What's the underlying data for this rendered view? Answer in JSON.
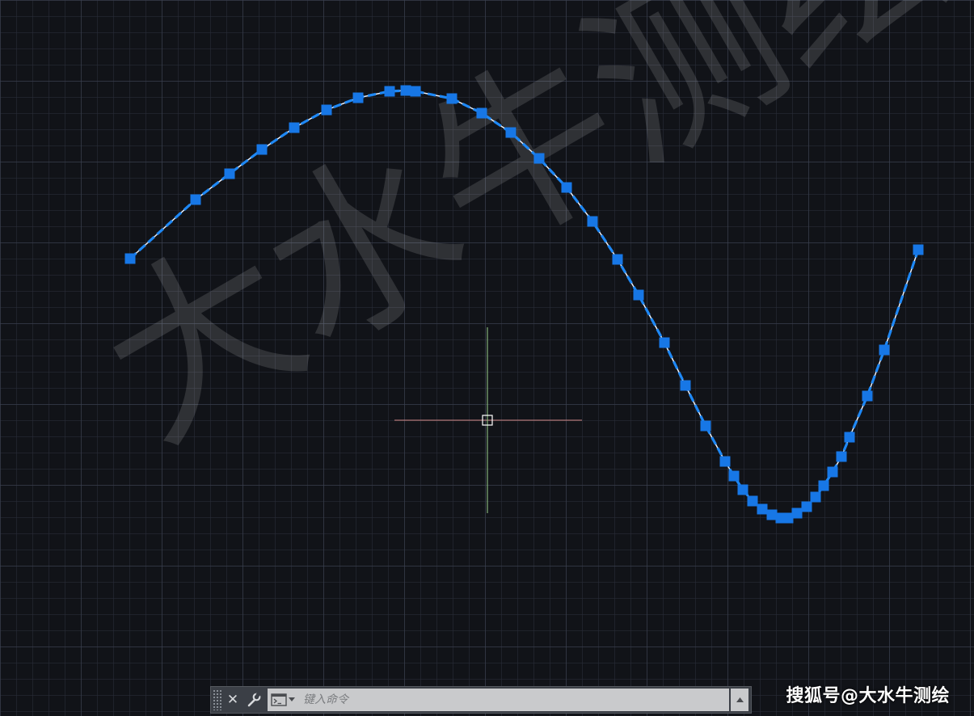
{
  "watermark": {
    "text": "大水牛测绘",
    "source_label": "搜狐号@大水牛测绘"
  },
  "command_line": {
    "placeholder": "键入命令",
    "close_label": "✕"
  },
  "colors": {
    "background": "#111318",
    "polyline": "#1e88f5",
    "grip": "#1777e6",
    "crosshair_x": "#d48a8a",
    "crosshair_y": "#9bd08d"
  },
  "drawing": {
    "entity": "polyline",
    "vertex_count": 45,
    "selected": true
  }
}
